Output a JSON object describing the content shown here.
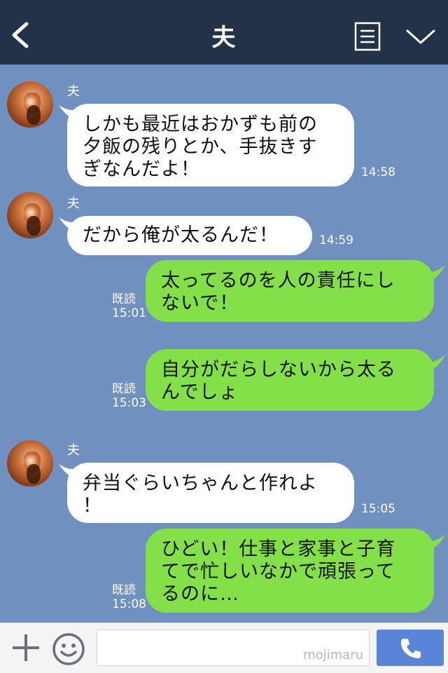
{
  "header": {
    "title": "夫"
  },
  "messages": [
    {
      "sender": "夫",
      "text": "しかも最近はおかずも前の夕飯の残りとか、手抜きすぎなんだよ！",
      "lines": [
        "しかも最近はおかずも前の",
        "夕飯の残りとか、手抜きす",
        "ぎなんだよ！"
      ],
      "time": "14:58",
      "direction": "incoming"
    },
    {
      "sender": "夫",
      "text": "だから俺が太るんだ！",
      "lines": [
        "だから俺が太るんだ！"
      ],
      "time": "14:59",
      "direction": "incoming"
    },
    {
      "text": "太ってるのを人の責任にしないで！",
      "lines": [
        "太ってるのを人の責任にし",
        "ないで！"
      ],
      "read_label": "既読",
      "time": "15:01",
      "direction": "outgoing"
    },
    {
      "text": "自分がだらしないから太るんでしょ",
      "lines": [
        "自分がだらしないから太る",
        "んでしょ"
      ],
      "read_label": "既読",
      "time": "15:03",
      "direction": "outgoing"
    },
    {
      "sender": "夫",
      "text": "弁当ぐらいちゃんと作れよ！",
      "lines": [
        "弁当ぐらいちゃんと作れよ",
        "！"
      ],
      "time": "15:05",
      "direction": "incoming"
    },
    {
      "text": "ひどい！仕事と家事と子育てで忙しいなかで頑張ってるのに…",
      "lines": [
        "ひどい！仕事と家事と子育",
        "てで忙しいなかで頑張って",
        "るのに…"
      ],
      "read_label": "既読",
      "time": "15:08",
      "direction": "outgoing"
    }
  ],
  "footer": {
    "input_value": "",
    "watermark": "mojimaru"
  },
  "colors": {
    "header_bg": "#243248",
    "chat_bg": "#7091c0",
    "incoming_bubble": "#ffffff",
    "outgoing_bubble": "#84e048",
    "call_button": "#5a84d8"
  },
  "icons": {
    "back": "chevron-left-icon",
    "note": "note-icon",
    "menu": "chevron-down-icon",
    "plus": "plus-icon",
    "emoji": "smiley-icon",
    "call": "phone-icon"
  }
}
